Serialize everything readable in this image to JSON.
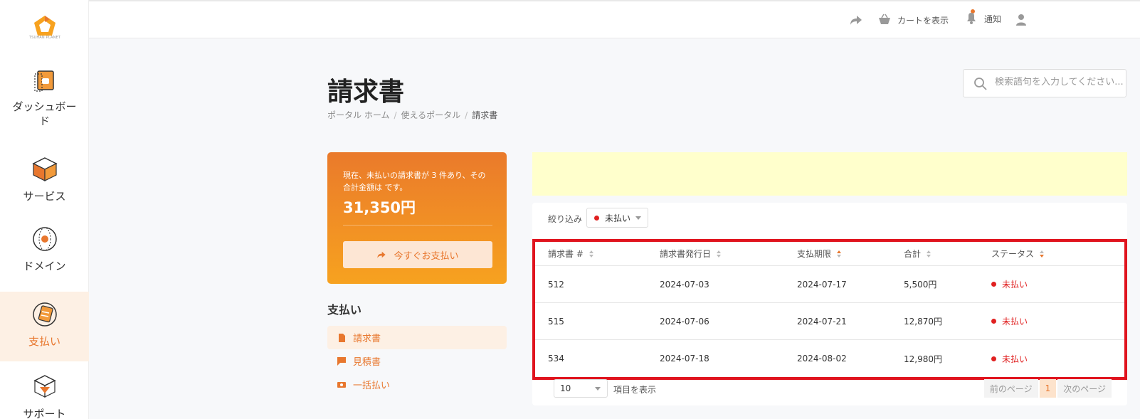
{
  "logo_text": "TSUHAN PLANET",
  "sidebar": {
    "items": [
      {
        "label": "ダッシュボード",
        "icon": "dashboard-icon"
      },
      {
        "label": "サービス",
        "icon": "box-icon"
      },
      {
        "label": "ドメイン",
        "icon": "globe-icon"
      },
      {
        "label": "支払い",
        "icon": "payment-icon"
      },
      {
        "label": "サポート",
        "icon": "support-icon"
      }
    ]
  },
  "topbar": {
    "cart_label": "カートを表示",
    "notify_label": "通知"
  },
  "page": {
    "title": "請求書",
    "breadcrumb": [
      "ポータル ホーム",
      "使えるポータル",
      "請求書"
    ],
    "search_placeholder": "検索語句を入力してください..."
  },
  "summary": {
    "description": "現在、未払いの請求書が 3 件あり、その合計金額は です。",
    "amount": "31,350円",
    "pay_button": "今すぐお支払い"
  },
  "pay_menu": {
    "heading": "支払い",
    "items": [
      "請求書",
      "見積書",
      "一括払い"
    ]
  },
  "filter": {
    "label": "絞り込み",
    "value": "未払い"
  },
  "table": {
    "columns": [
      "請求書 #",
      "請求書発行日",
      "支払期限",
      "合計",
      "ステータス"
    ],
    "rows": [
      {
        "invoice": "512",
        "issued": "2024-07-03",
        "due": "2024-07-17",
        "total": "5,500円",
        "status": "未払い"
      },
      {
        "invoice": "515",
        "issued": "2024-07-06",
        "due": "2024-07-21",
        "total": "12,870円",
        "status": "未払い"
      },
      {
        "invoice": "534",
        "issued": "2024-07-18",
        "due": "2024-08-02",
        "total": "12,980円",
        "status": "未払い"
      }
    ]
  },
  "footer": {
    "per_page": "10",
    "per_page_label": "項目を表示",
    "prev": "前のページ",
    "page": "1",
    "next": "次のページ"
  },
  "colors": {
    "accent": "#e8772e",
    "status_unpaid": "#e02020",
    "highlight_border": "#e0141e",
    "notice_bg": "#ffffcc"
  }
}
